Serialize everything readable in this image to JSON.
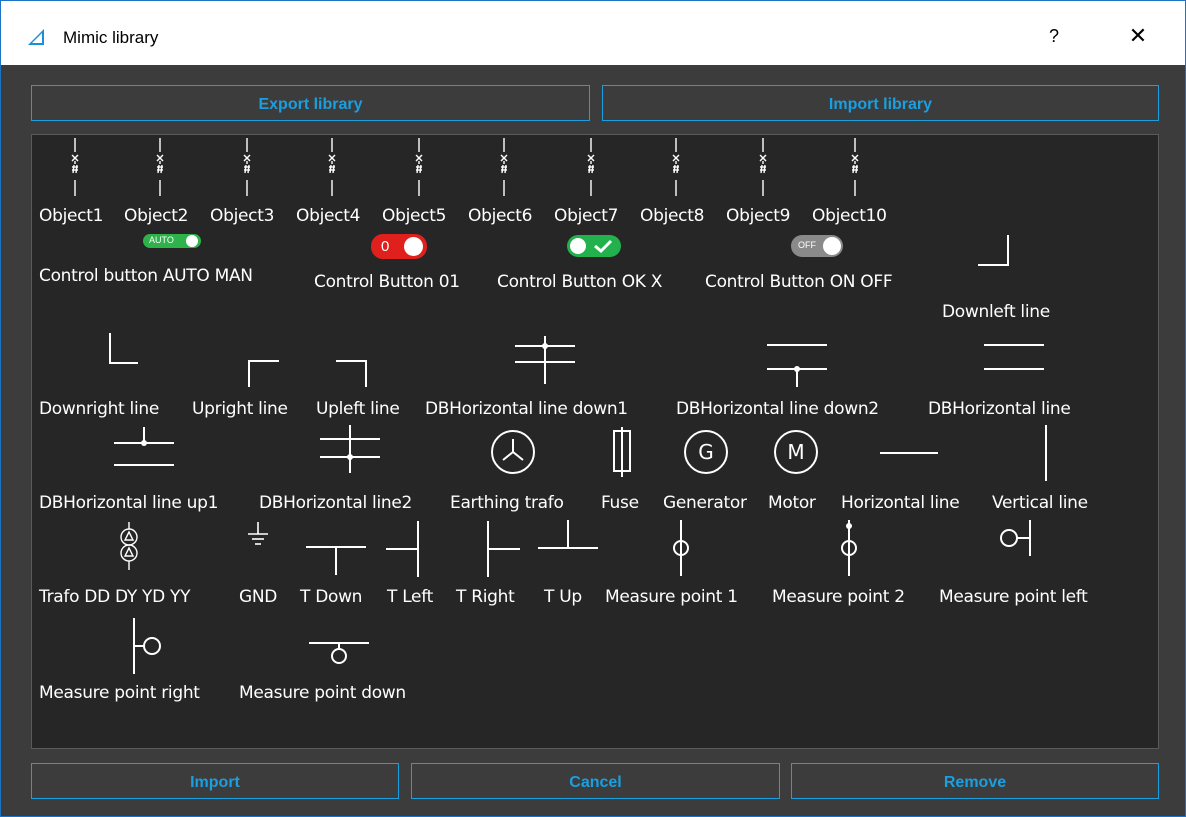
{
  "window": {
    "title": "Mimic library",
    "help_label": "?",
    "close_label": "✕"
  },
  "toolbar": {
    "export_label": "Export library",
    "import_library_label": "Import library"
  },
  "footer": {
    "import_label": "Import",
    "cancel_label": "Cancel",
    "remove_label": "Remove"
  },
  "colors": {
    "accent": "#1a9fe0",
    "panel": "#3c3c3c",
    "canvas": "#262626",
    "auto_green": "#2db34a",
    "red": "#e0201c",
    "ok_green": "#22b14c",
    "off_gray": "#8a8a8a"
  },
  "icons": {
    "app": "triangle-logo-icon",
    "help": "question-icon",
    "close": "close-icon"
  },
  "toggles": {
    "auto_text": "AUTO",
    "zero_text": "0",
    "off_text": "OFF"
  },
  "symbols": {
    "objects": [
      "Object1",
      "Object2",
      "Object3",
      "Object4",
      "Object5",
      "Object6",
      "Object7",
      "Object8",
      "Object9",
      "Object10"
    ],
    "control_auto": "Control button AUTO MAN",
    "control_01": "Control Button 01",
    "control_ok": "Control Button OK X",
    "control_onoff": "Control Button ON OFF",
    "downleft": "Downleft line",
    "downright": "Downright line",
    "upright": "Upright line",
    "upleft": "Upleft line",
    "dbh_down1": "DBHorizontal line down1",
    "dbh_down2": "DBHorizontal line down2",
    "dbh": "DBHorizontal line",
    "dbh_up1": "DBHorizontal line up1",
    "dbh2": "DBHorizontal line2",
    "earthing": "Earthing trafo",
    "fuse": "Fuse",
    "generator": "Generator",
    "generator_glyph": "G",
    "motor": "Motor",
    "motor_glyph": "M",
    "hline": "Horizontal line",
    "vline": "Vertical line",
    "trafo": "Trafo DD DY YD YY",
    "gnd": "GND",
    "tdown": "T Down",
    "tleft": "T Left",
    "tright": "T Right",
    "tup": "T Up",
    "mp1": "Measure point 1",
    "mp2": "Measure point 2",
    "mpleft": "Measure point left",
    "mpright": "Measure point right",
    "mpdown": "Measure point down"
  }
}
